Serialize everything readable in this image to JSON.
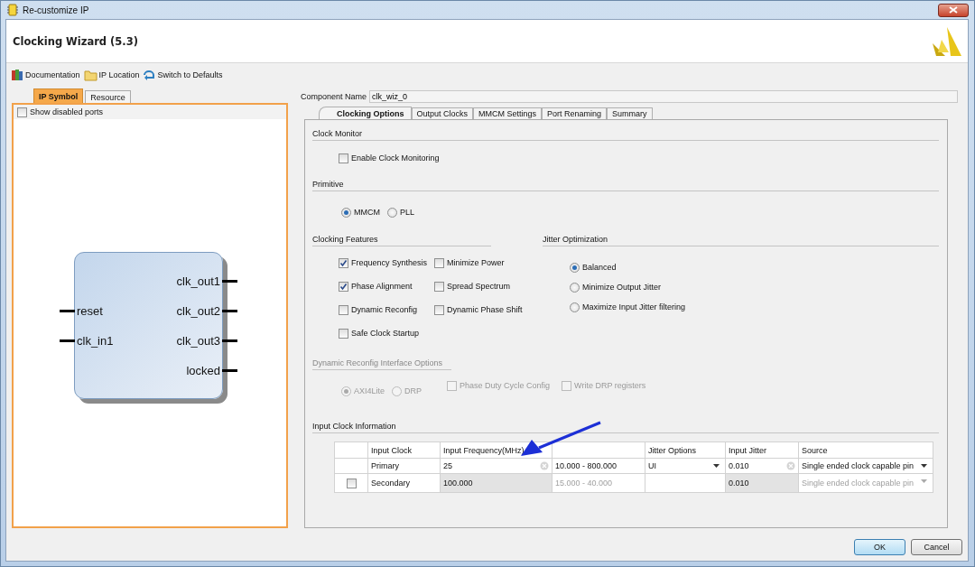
{
  "window": {
    "title": "Re-customize IP"
  },
  "header": {
    "title": "Clocking Wizard (5.3)"
  },
  "toolbar": [
    {
      "label": "Documentation",
      "kind": "books"
    },
    {
      "label": "IP Location",
      "kind": "folder"
    },
    {
      "label": "Switch to Defaults",
      "kind": "refresh"
    }
  ],
  "left_tabs": [
    {
      "label": "IP Symbol",
      "selected": true
    },
    {
      "label": "Resource",
      "selected": false
    }
  ],
  "show_disabled_ports": {
    "label": "Show disabled ports",
    "checked": false
  },
  "ip_symbol": {
    "inputs": [
      "reset",
      "clk_in1"
    ],
    "outputs": [
      "clk_out1",
      "clk_out2",
      "clk_out3",
      "locked"
    ]
  },
  "component_name": {
    "label": "Component Name",
    "value": "clk_wiz_0"
  },
  "tabs": [
    {
      "label": "Clocking Options",
      "selected": true
    },
    {
      "label": "Output Clocks",
      "selected": false
    },
    {
      "label": "MMCM Settings",
      "selected": false
    },
    {
      "label": "Port Renaming",
      "selected": false
    },
    {
      "label": "Summary",
      "selected": false
    }
  ],
  "clock_monitor": {
    "title": "Clock Monitor",
    "options": [
      {
        "label": "Enable Clock Monitoring",
        "checked": false
      }
    ]
  },
  "primitive": {
    "title": "Primitive",
    "options": [
      {
        "label": "MMCM",
        "selected": true
      },
      {
        "label": "PLL",
        "selected": false
      }
    ]
  },
  "clocking_features": {
    "title": "Clocking Features",
    "options": [
      {
        "label": "Frequency Synthesis",
        "checked": true
      },
      {
        "label": "Minimize Power",
        "checked": false
      },
      {
        "label": "Phase Alignment",
        "checked": true
      },
      {
        "label": "Spread Spectrum",
        "checked": false
      },
      {
        "label": "Dynamic Reconfig",
        "checked": false
      },
      {
        "label": "Dynamic Phase Shift",
        "checked": false
      },
      {
        "label": "Safe Clock Startup",
        "checked": false
      }
    ]
  },
  "jitter_optimization": {
    "title": "Jitter Optimization",
    "options": [
      {
        "label": "Balanced",
        "selected": true
      },
      {
        "label": "Minimize Output Jitter",
        "selected": false
      },
      {
        "label": "Maximize Input Jitter filtering",
        "selected": false
      }
    ]
  },
  "dynamic_reconfig": {
    "title": "Dynamic Reconfig Interface Options",
    "disabled": true,
    "interface": [
      {
        "label": "AXI4Lite",
        "selected": true
      },
      {
        "label": "DRP",
        "selected": false
      }
    ],
    "options": [
      {
        "label": "Phase Duty Cycle Config",
        "checked": false
      },
      {
        "label": "Write DRP registers",
        "checked": false
      }
    ]
  },
  "input_clock": {
    "title": "Input Clock Information",
    "columns": [
      "Input Clock",
      "Input Frequency(MHz)",
      "Jitter Options",
      "Input Jitter",
      "Source"
    ],
    "rows": [
      {
        "input_clock": "Primary",
        "enabled": true,
        "frequency": "25",
        "range": "10.000 - 800.000",
        "jitter_option": "UI",
        "input_jitter": "0.010",
        "source": "Single ended clock capable pin"
      },
      {
        "input_clock": "Secondary",
        "enabled": false,
        "checkbox": {
          "checked": false
        },
        "frequency": "100.000",
        "range": "15.000 - 40.000",
        "input_jitter": "0.010",
        "source": "Single ended clock capable pin"
      }
    ]
  },
  "buttons": [
    {
      "label": "OK",
      "default": true
    },
    {
      "label": "Cancel",
      "default": false
    }
  ]
}
